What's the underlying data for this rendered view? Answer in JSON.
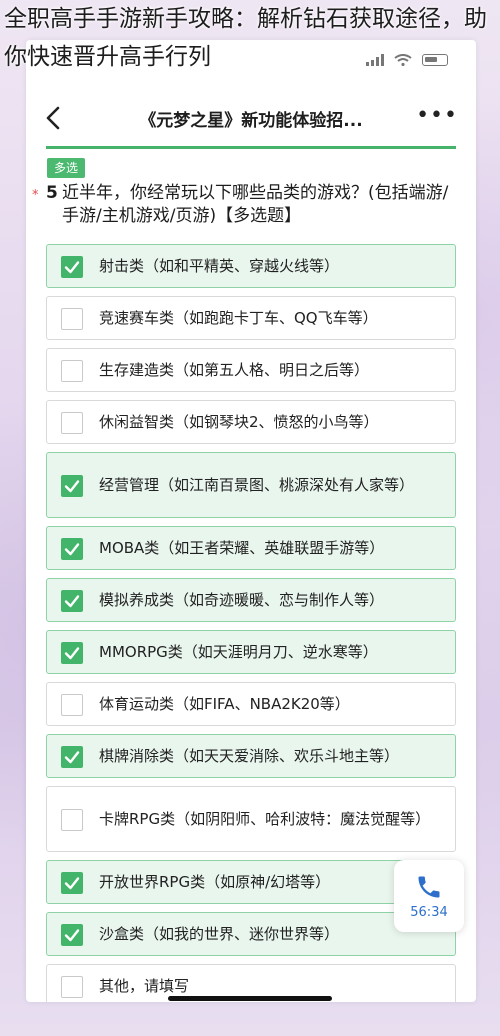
{
  "page_caption": "全职高手手游新手攻略：解析钻石获取途径，助你快速晋升高手行列",
  "nav": {
    "title": "《元梦之星》新功能体验招..."
  },
  "tag": "多选",
  "question": {
    "required_mark": "*",
    "number": "5",
    "text": "近半年，你经常玩以下哪些品类的游戏？(包括端游/手游/主机游戏/页游)【多选题】"
  },
  "options": [
    {
      "label": "射击类（如和平精英、穿越火线等）",
      "checked": true
    },
    {
      "label": "竞速赛车类（如跑跑卡丁车、QQ飞车等）",
      "checked": false
    },
    {
      "label": "生存建造类（如第五人格、明日之后等）",
      "checked": false
    },
    {
      "label": "休闲益智类（如钢琴块2、愤怒的小鸟等）",
      "checked": false
    },
    {
      "label": "经营管理（如江南百景图、桃源深处有人家等）",
      "checked": true
    },
    {
      "label": "MOBA类（如王者荣耀、英雄联盟手游等）",
      "checked": true
    },
    {
      "label": "模拟养成类（如奇迹暖暖、恋与制作人等）",
      "checked": true
    },
    {
      "label": "MMORPG类（如天涯明月刀、逆水寒等）",
      "checked": true
    },
    {
      "label": "体育运动类（如FIFA、NBA2K20等）",
      "checked": false
    },
    {
      "label": "棋牌消除类（如天天爱消除、欢乐斗地主等）",
      "checked": true
    },
    {
      "label": "卡牌RPG类（如阴阳师、哈利波特：魔法觉醒等）",
      "checked": false
    },
    {
      "label": "开放世界RPG类（如原神/幻塔等）",
      "checked": true
    },
    {
      "label": "沙盒类（如我的世界、迷你世界等）",
      "checked": true
    },
    {
      "label": "其他，请填写",
      "checked": false
    }
  ],
  "call": {
    "time": "56:34",
    "icon": "phone-icon"
  },
  "colors": {
    "accent": "#43b56a",
    "checked_bg": "#e9f6ee",
    "required": "#e24c4c",
    "call_blue": "#2d6fcb"
  }
}
